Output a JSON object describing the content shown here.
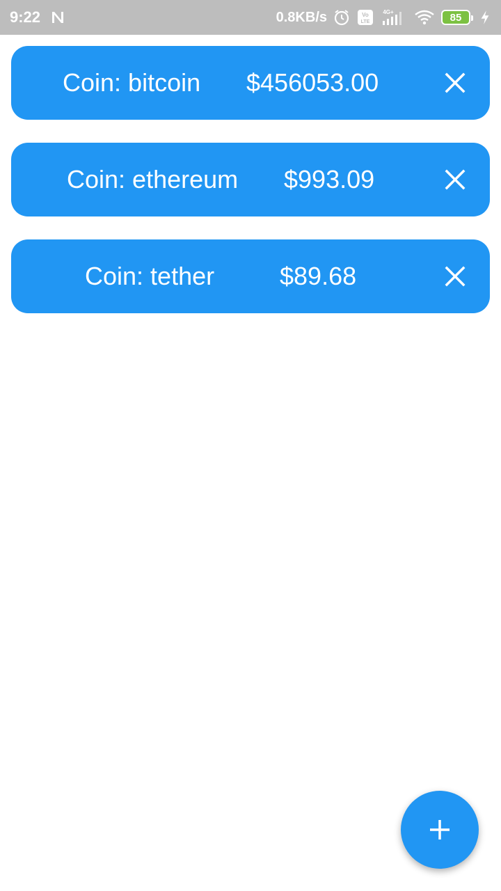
{
  "status_bar": {
    "time": "9:22",
    "net_speed": "0.8KB/s",
    "battery": "85",
    "icons": [
      "n-notification-icon",
      "alarm-icon",
      "volte-icon",
      "signal-4g-icon",
      "wifi-icon",
      "battery-icon",
      "charging-icon"
    ],
    "net_type": "4G+"
  },
  "coins": [
    {
      "name": "Coin: bitcoin",
      "price": "$456053.00"
    },
    {
      "name": "Coin: ethereum",
      "price": "$993.09"
    },
    {
      "name": "Coin: tether",
      "price": "$89.68"
    }
  ],
  "colors": {
    "accent": "#2196f3",
    "status_bar": "#bdbdbd",
    "battery": "#7cc142"
  },
  "fab": {
    "icon": "plus-icon"
  }
}
